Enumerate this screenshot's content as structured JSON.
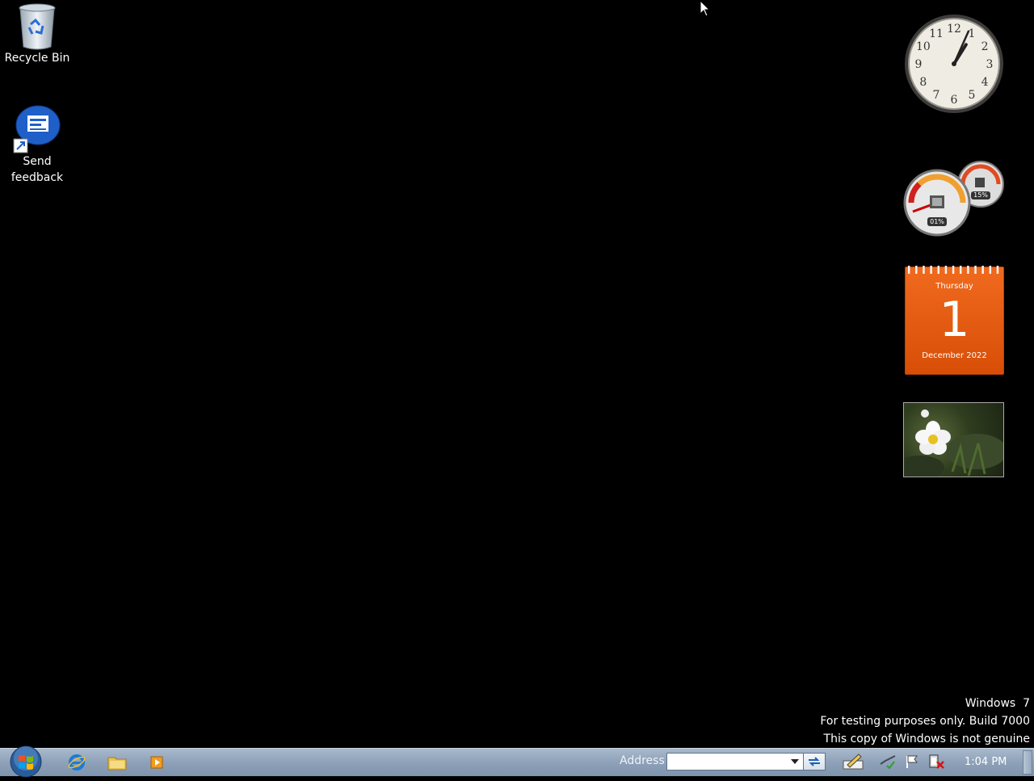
{
  "desktop": {
    "icons": [
      {
        "label": "Recycle Bin",
        "icon": "recycle-bin-icon"
      },
      {
        "label": "Send\nfeedback",
        "icon": "send-feedback-icon"
      }
    ]
  },
  "gadgets": {
    "clock": {
      "hour": 1,
      "minute": 4,
      "numerals": [
        "12",
        "1",
        "2",
        "3",
        "4",
        "5",
        "6",
        "7",
        "8",
        "9",
        "10",
        "11"
      ]
    },
    "cpu_meter": {
      "cpu": "01%",
      "memory": "15%"
    },
    "calendar": {
      "day_name": "Thursday",
      "day_number": "1",
      "month_year": "December 2022"
    },
    "slideshow": {
      "image": "white-flower-photo"
    }
  },
  "watermark": {
    "line1": "Windows  7",
    "line2": "For testing purposes only. Build 7000",
    "line3": "This copy of Windows is not genuine"
  },
  "taskbar": {
    "start_icon": "windows-orb-icon",
    "pinned": [
      "internet-explorer-icon",
      "windows-explorer-icon",
      "media-player-icon"
    ],
    "address": {
      "label": "Address",
      "value": ""
    },
    "tray_icons": [
      "pen-input-icon",
      "network-icon",
      "action-center-flag-icon",
      "power-icon"
    ],
    "time": "1:04 PM"
  },
  "colors": {
    "taskbar": "#8ea1b8",
    "calendar": "#e85d10",
    "desktop": "#000000"
  }
}
